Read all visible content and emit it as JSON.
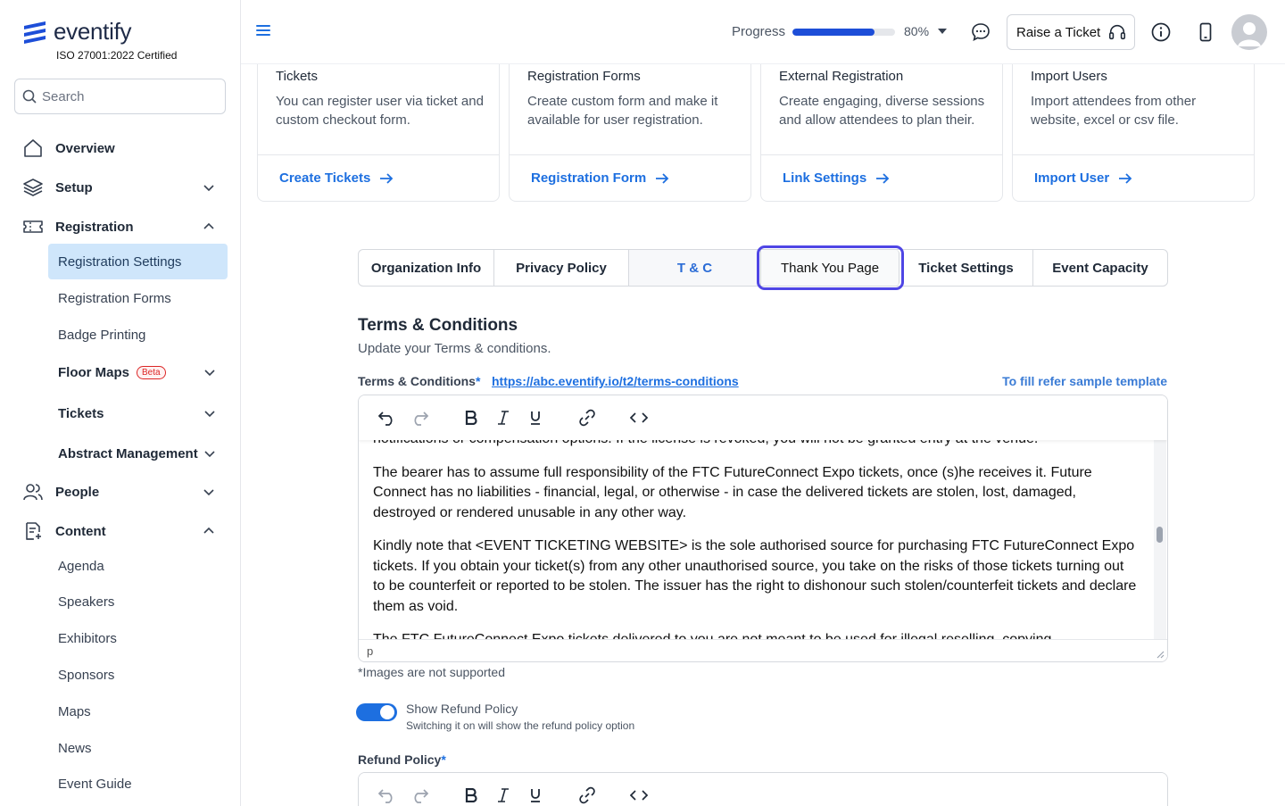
{
  "brand": {
    "name": "eventify",
    "certification": "ISO 27001:2022 Certified"
  },
  "search": {
    "placeholder": "Search"
  },
  "sidebar": {
    "overview": "Overview",
    "setup": "Setup",
    "registration": "Registration",
    "registration_items": [
      "Registration Settings",
      "Registration Forms",
      "Badge Printing"
    ],
    "floor_maps": "Floor Maps",
    "beta": "Beta",
    "tickets": "Tickets",
    "abstract": "Abstract Management",
    "people": "People",
    "content": "Content",
    "content_items": [
      "Agenda",
      "Speakers",
      "Exhibitors",
      "Sponsors",
      "Maps",
      "News",
      "Event Guide"
    ]
  },
  "header": {
    "progress_label": "Progress",
    "progress_value": 0.8,
    "progress_pct": "80%",
    "raise_ticket": "Raise a Ticket"
  },
  "cards": [
    {
      "title": "Tickets",
      "desc": "You can register user via ticket and custom checkout form.",
      "link": "Create Tickets"
    },
    {
      "title": "Registration Forms",
      "desc": "Create custom form and make it available for user registration.",
      "link": "Registration Form"
    },
    {
      "title": "External Registration",
      "desc": "Create engaging, diverse sessions and allow attendees to plan their.",
      "link": "Link Settings"
    },
    {
      "title": "Import Users",
      "desc": "Import attendees from other website, excel or csv file.",
      "link": "Import User"
    }
  ],
  "tabs": [
    "Organization Info",
    "Privacy Policy",
    "T & C",
    "Thank You Page",
    "Ticket Settings",
    "Event Capacity"
  ],
  "terms": {
    "title": "Terms & Conditions",
    "subtitle": "Update your Terms & conditions.",
    "label": "Terms & Conditions",
    "required": "*",
    "url": "https://abc.eventify.io/t2/terms-conditions",
    "refer": "To fill refer sample template",
    "paragraphs": [
      "notifications or compensation options. If the license is revoked, you will not be granted entry at the venue.",
      "The bearer has to assume full responsibility of the FTC FutureConnect Expo tickets, once (s)he receives it. Future Connect has no liabilities - financial, legal, or otherwise - in case the delivered tickets are stolen, lost, damaged, destroyed or rendered unusable in any other way.",
      "Kindly note that <EVENT TICKETING WEBSITE> is the sole authorised source for purchasing FTC FutureConnect Expo tickets. If you obtain your ticket(s) from any other unauthorised source, you take on the risks of those tickets turning out to be counterfeit or reported to be stolen. The issuer has the right to dishonour such stolen/counterfeit tickets and declare them as void.",
      "The FTC FutureConnect Expo tickets delivered to you are not meant to be used for illegal reselling, copying"
    ],
    "status_tag": "p",
    "note": "*Images are not supported"
  },
  "refund": {
    "toggle_label": "Show Refund Policy",
    "toggle_desc": "Switching it on will show the refund policy option",
    "toggle_on": true,
    "label": "Refund Policy",
    "required": "*"
  },
  "colors": {
    "accent": "#1d6fe0",
    "active_bg": "#cfe6fb",
    "focus": "#4f46e5"
  }
}
